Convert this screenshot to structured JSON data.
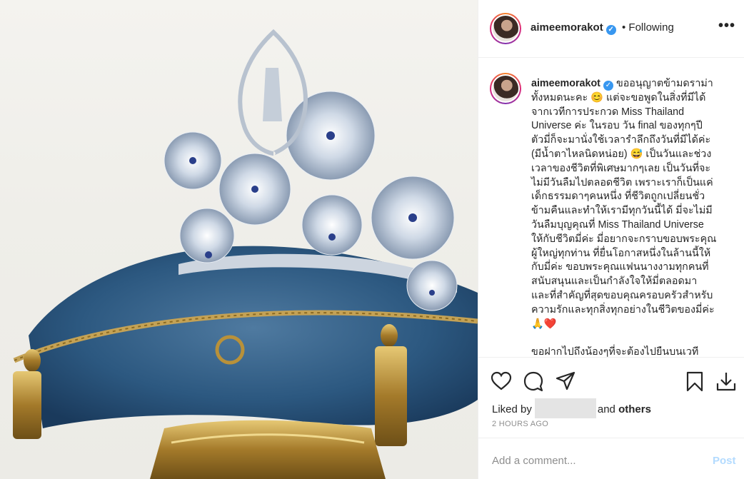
{
  "post": {
    "username": "aimeemorakot",
    "verified_icon": "verified-badge-icon",
    "follow_status": "• Following",
    "more_icon": "•••",
    "caption_lines": [
      "ขออนุญาตข้ามดราม่า",
      "ทั้งหมดนะคะ 😊 แต่จะขอพูดในสิ่งที่มีได้",
      "จากเวทีการประกวด Miss Thailand",
      "Universe ค่ะ ในรอบ วัน final ของทุกๆปี",
      "ตัวมี่ก็จะมานั่งใช้เวลารำลึกถึงวันที่มีได้ค่ะ",
      "(มีน้ำตาไหลนิดหน่อย) 😅 เป็นวันและช่วง",
      "เวลาของชีวิตที่พิเศษมากๆเลย เป็นวันที่จะ",
      "ไม่มีวันลืมไปตลอดชีวิต เพราะเราก็เป็นแค่",
      "เด็กธรรมดาๆคนหนึ่ง ที่ชีวิตถูกเปลี่ยนชั่ว",
      "ข้ามคืนและทำให้เรามีทุกวันนี้ได้ มี่จะไม่มี",
      "วันลืมบุญคุณที่ Miss Thailand Universe",
      "ให้กับชีวิตมี่ค่ะ มี่อยากจะกราบขอบพระคุณ",
      "ผู้ใหญ่ทุกท่าน ที่ยื่นโอกาสหนึ่งในล้านนี้ให้",
      "กับมี่ค่ะ ขอบพระคุณแฟนนางงามทุกคนที่",
      "สนับสนุนและเป็นกำลังใจให้มี่ตลอดมา",
      "และที่สำคัญที่สุดขอบคุณครอบครัวสำหรับ",
      "ความรักและทุกสิ่งทุกอย่างในชีวิตของมี่ค่ะ",
      "🙏❤️"
    ],
    "caption_next_line": "ขอฝากไปถึงน้องๆที่จะต้องไปยืนบนเวที",
    "liked_by_prefix": "Liked by",
    "liked_by_and": "and",
    "liked_by_others": "others",
    "timestamp": "2 HOURS AGO",
    "comment_placeholder": "Add a comment...",
    "post_button": "Post"
  },
  "colors": {
    "link_blue": "#3897f0",
    "post_disabled": "#b3dbff",
    "pillow": "#2e5a80",
    "gold": "#b8913a"
  }
}
